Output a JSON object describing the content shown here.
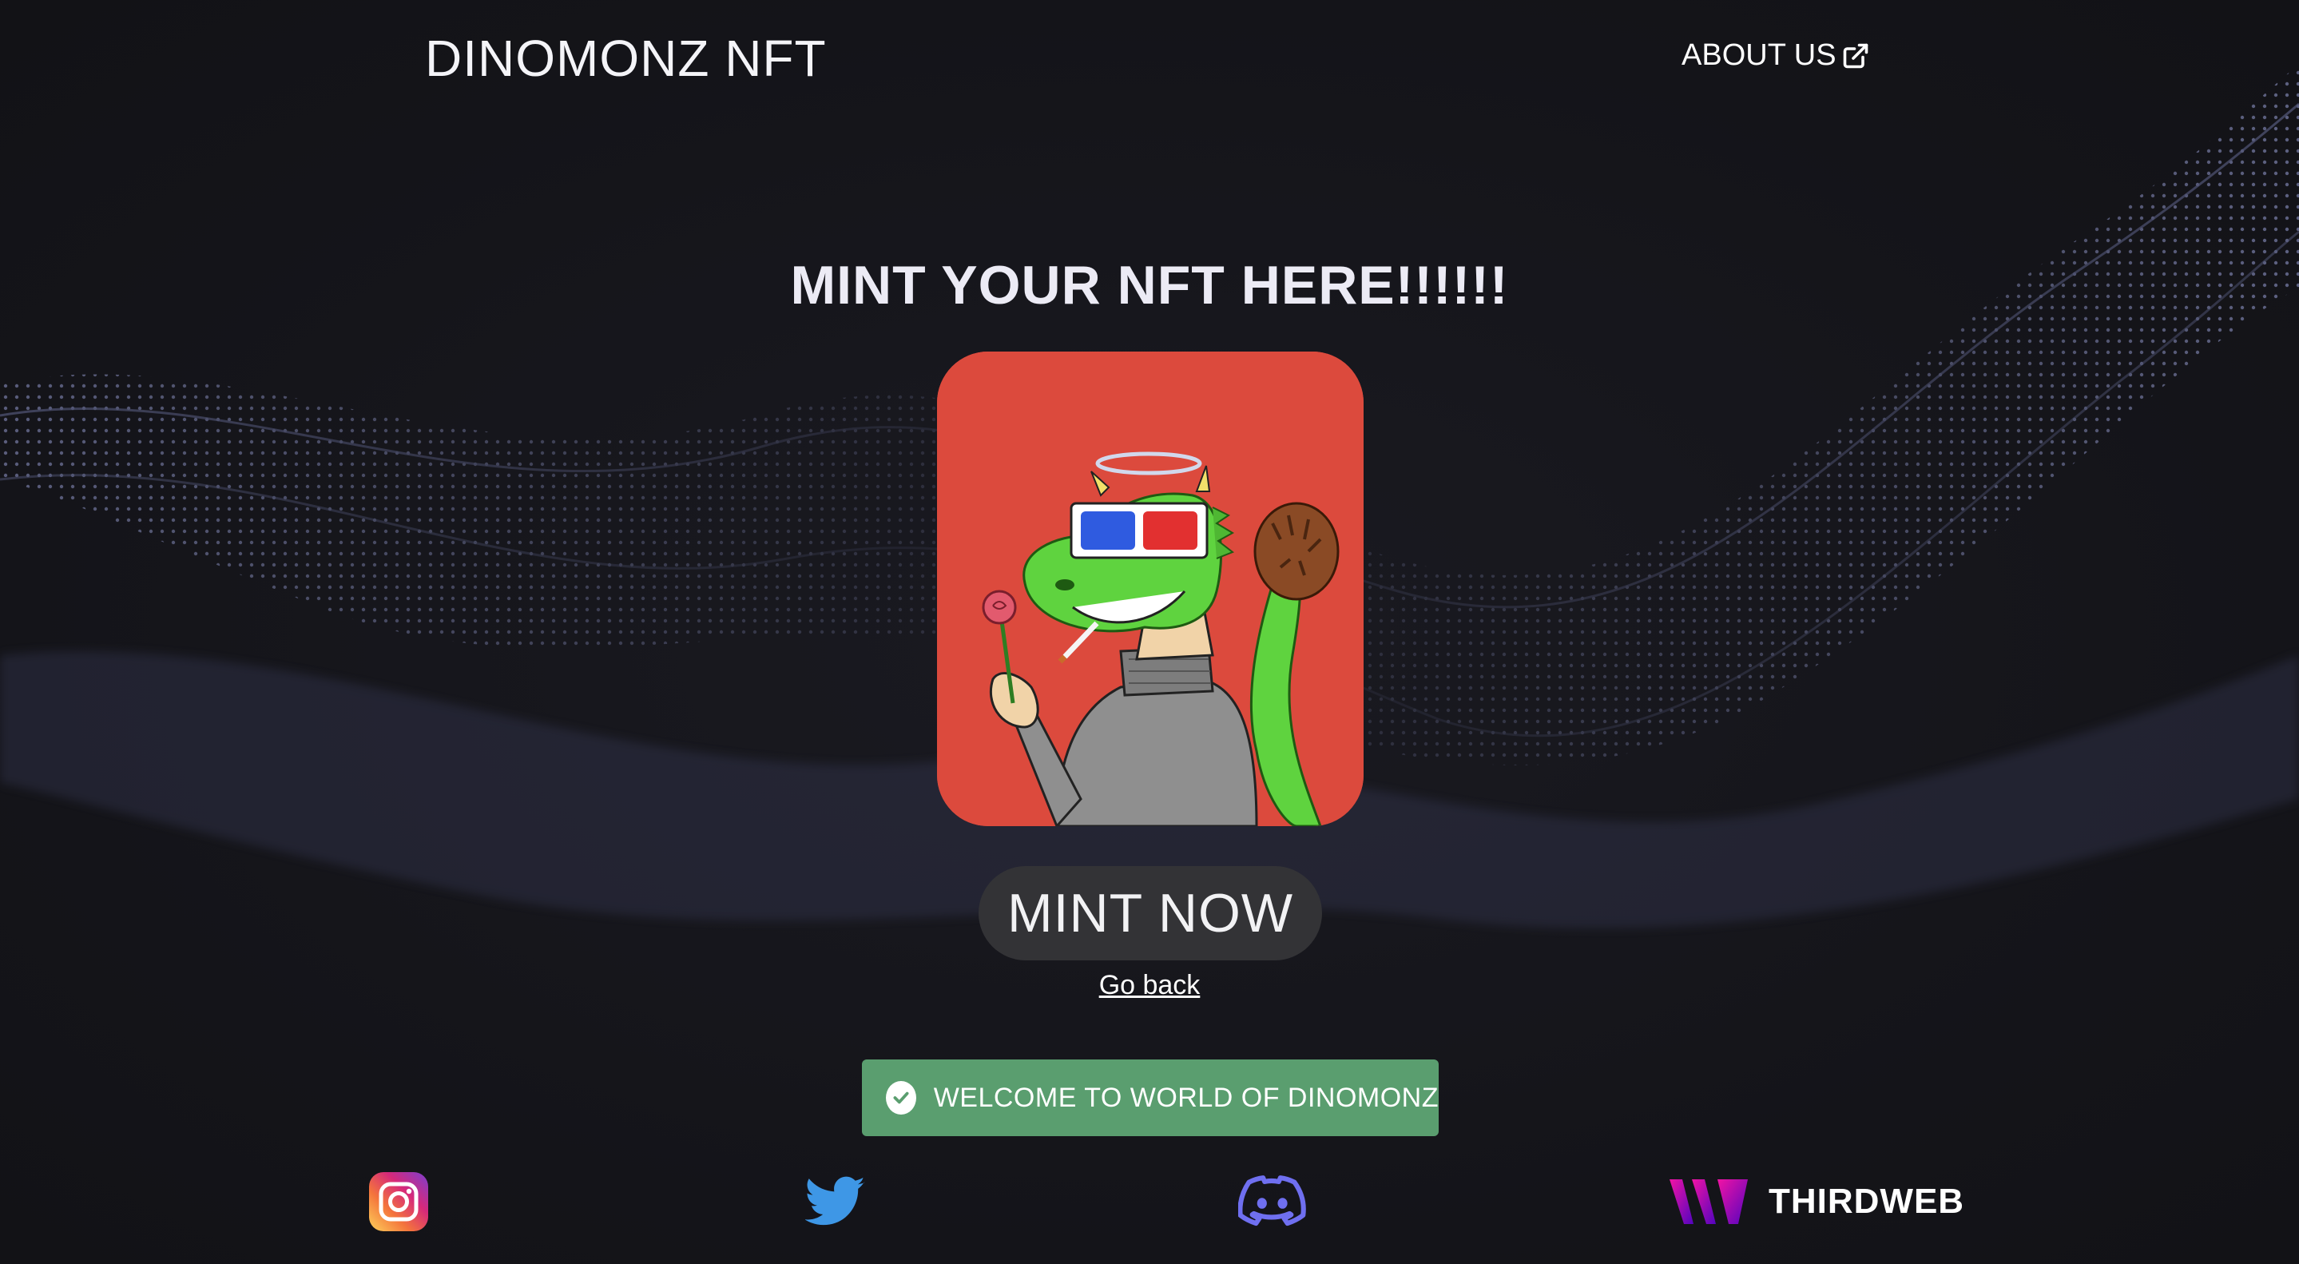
{
  "header": {
    "title": "DINOMONZ NFT",
    "about_label": "ABOUT US"
  },
  "main": {
    "headline": "MINT YOUR NFT HERE!!!!!!",
    "mint_button_label": "MINT NOW",
    "go_back_label": "Go back"
  },
  "toast": {
    "message": "WELCOME TO WORLD OF DINOMONZ",
    "color": "#5a9e6f"
  },
  "footer": {
    "socials": [
      {
        "icon": "instagram-icon"
      },
      {
        "icon": "twitter-icon"
      },
      {
        "icon": "discord-icon"
      }
    ],
    "thirdweb_label": "THIRDWEB"
  },
  "colors": {
    "background": "#15151a",
    "nft_card_bg": "#dc4a3d",
    "button_bg": "#333336",
    "wave": "#8c96d8"
  }
}
